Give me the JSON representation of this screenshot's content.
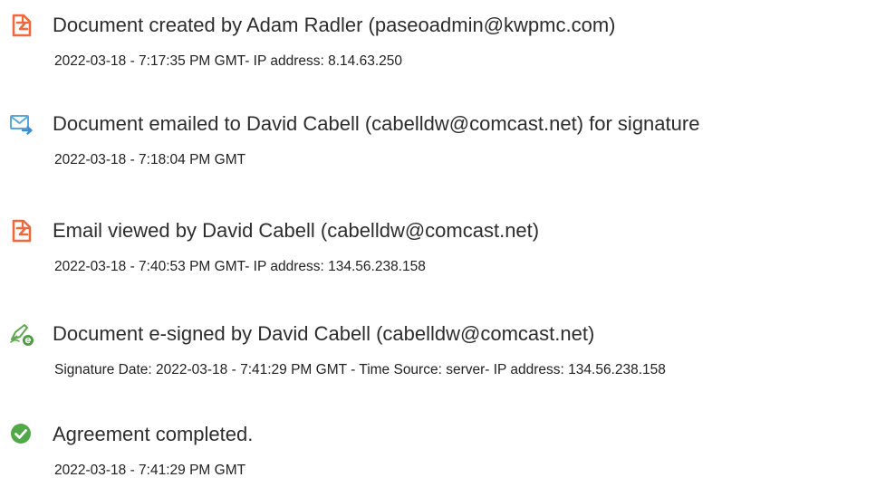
{
  "events": [
    {
      "icon": "document-created-icon",
      "title": "Document created by Adam Radler (paseoadmin@kwpmc.com)",
      "detail": "2022-03-18 - 7:17:35 PM GMT- IP address: 8.14.63.250"
    },
    {
      "icon": "email-sent-icon",
      "title": "Document emailed to David Cabell (cabelldw@comcast.net) for signature",
      "detail": "2022-03-18 - 7:18:04 PM GMT"
    },
    {
      "icon": "document-viewed-icon",
      "title": "Email viewed by David Cabell (cabelldw@comcast.net)",
      "detail": "2022-03-18 - 7:40:53 PM GMT- IP address: 134.56.238.158"
    },
    {
      "icon": "esign-pen-icon",
      "title": "Document e-signed by David Cabell (cabelldw@comcast.net)",
      "detail": "Signature Date: 2022-03-18 - 7:41:29 PM GMT - Time Source: server- IP address: 134.56.238.158"
    },
    {
      "icon": "checkmark-circle-icon",
      "title": "Agreement completed.",
      "detail": "2022-03-18 - 7:41:29 PM GMT"
    }
  ],
  "colors": {
    "document_icon": "#f0693c",
    "email_icon": "#5aa7de",
    "esign_icon": "#5ba84e",
    "check_icon": "#4fa947"
  }
}
